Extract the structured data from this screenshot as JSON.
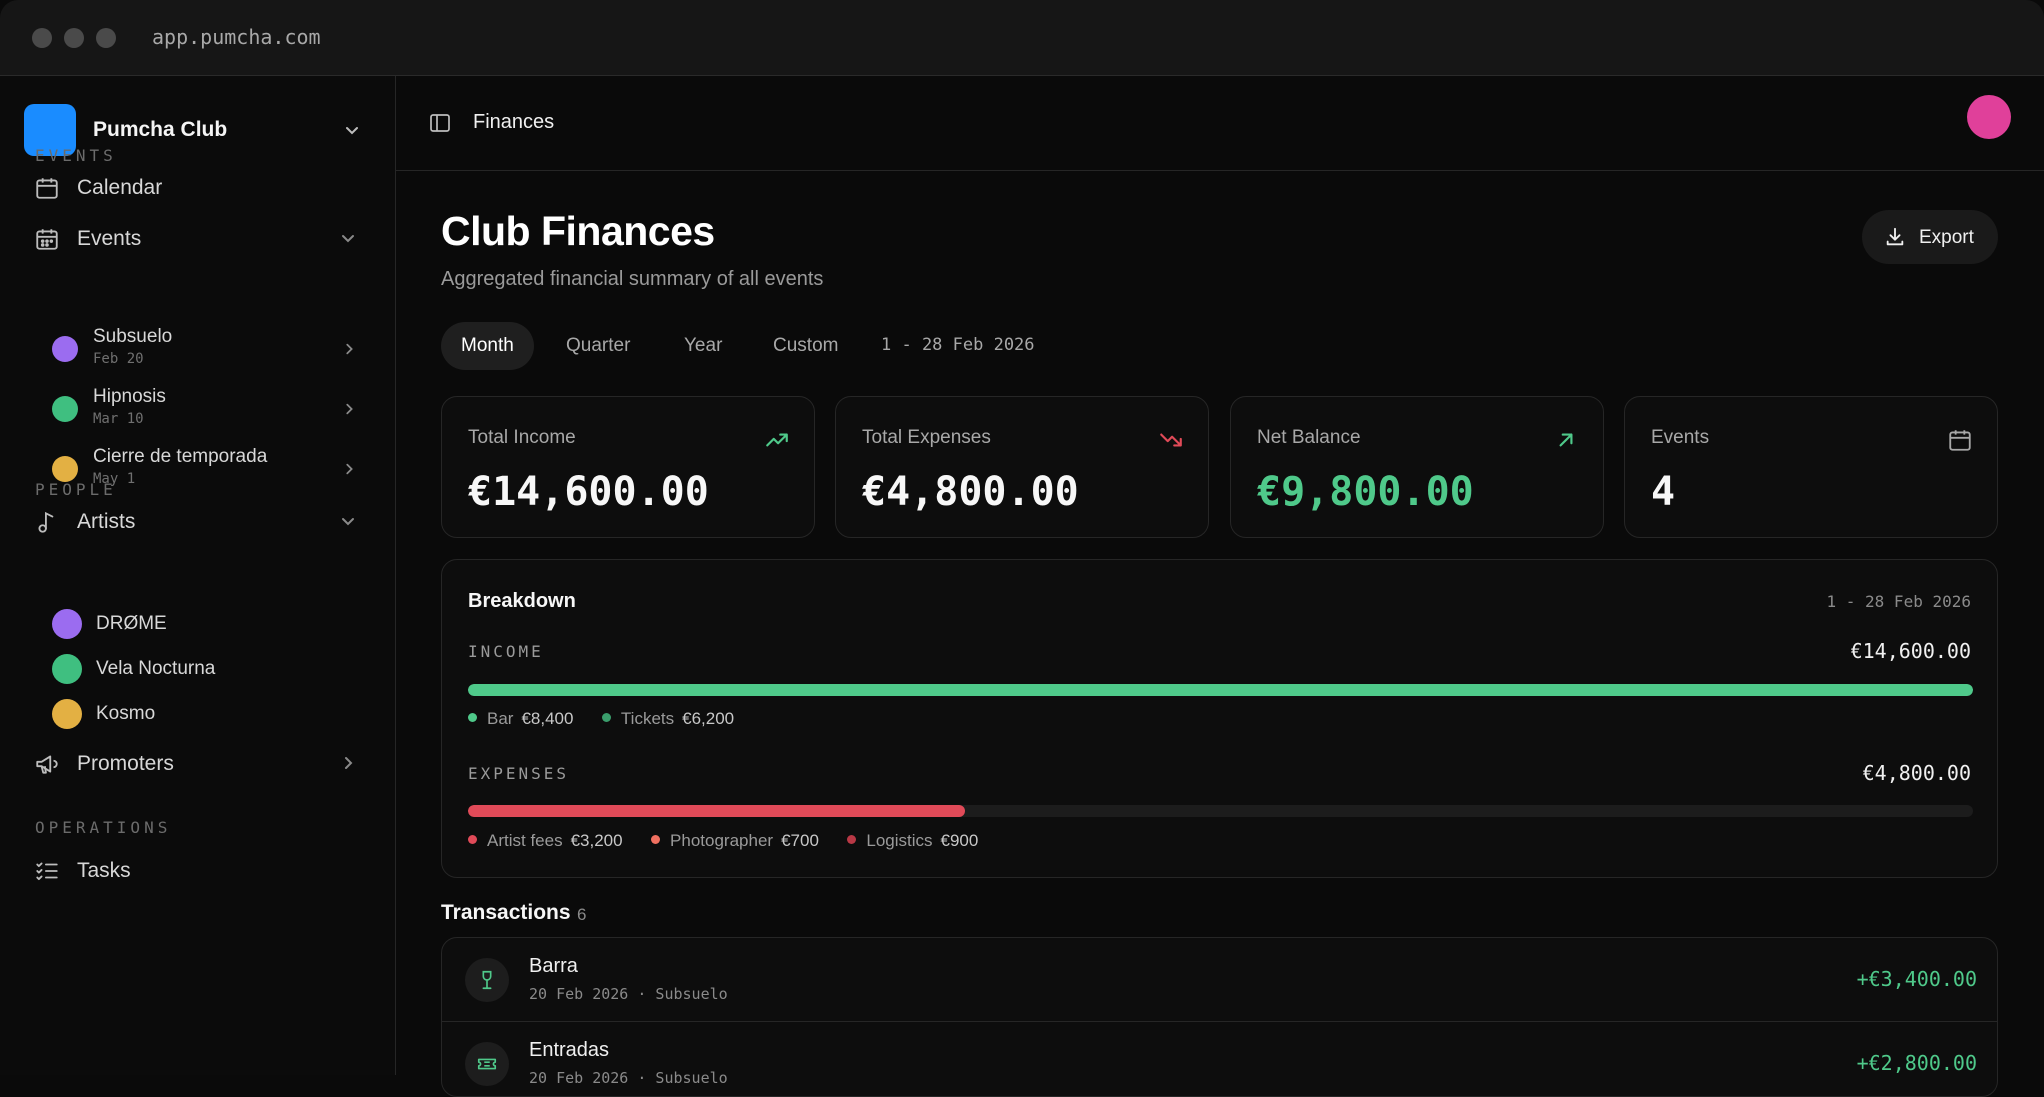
{
  "browser": {
    "url": "app.pumcha.com"
  },
  "club": {
    "name": "Pumcha Club",
    "logo_color": "#1a8cff"
  },
  "sidebar": {
    "sections": {
      "events": "EVENTS",
      "people": "PEOPLE",
      "operations": "OPERATIONS"
    },
    "calendar": "Calendar",
    "events": {
      "label": "Events",
      "items": [
        {
          "name": "Subsuelo",
          "date": "Feb 20",
          "color": "#9b6cf0"
        },
        {
          "name": "Hipnosis",
          "date": "Mar 10",
          "color": "#3fbf80"
        },
        {
          "name": "Cierre de temporada",
          "date": "May 1",
          "color": "#e3b043"
        }
      ]
    },
    "artists": {
      "label": "Artists",
      "items": [
        {
          "name": "DRØME",
          "color": "#9b6cf0"
        },
        {
          "name": "Vela Nocturna",
          "color": "#3fbf80"
        },
        {
          "name": "Kosmo",
          "color": "#e3b043"
        }
      ]
    },
    "promoters": "Promoters",
    "tasks": "Tasks"
  },
  "header": {
    "breadcrumb": "Finances",
    "avatar_color": "#e0409a"
  },
  "page": {
    "title": "Club Finances",
    "subtitle": "Aggregated financial summary of all events",
    "export_label": "Export"
  },
  "period": {
    "tabs": [
      "Month",
      "Quarter",
      "Year",
      "Custom"
    ],
    "active": "Month",
    "range": "1 - 28 Feb 2026"
  },
  "cards": [
    {
      "label": "Total Income",
      "value": "€14,600.00",
      "icon": "trending-up-icon"
    },
    {
      "label": "Total Expenses",
      "value": "€4,800.00",
      "icon": "trending-down-icon"
    },
    {
      "label": "Net Balance",
      "value": "€9,800.00",
      "icon": "arrow-up-right-icon"
    },
    {
      "label": "Events",
      "value": "4",
      "icon": "calendar-icon"
    }
  ],
  "breakdown": {
    "title": "Breakdown",
    "range": "1 - 28 Feb 2026",
    "income": {
      "label": "INCOME",
      "total": "€14,600.00",
      "fill_fraction": 1.0,
      "color": "#4fc98a",
      "items": [
        {
          "name": "Bar",
          "value": "€8,400",
          "color": "#4fc98a"
        },
        {
          "name": "Tickets",
          "value": "€6,200",
          "color": "#3a9e6c"
        }
      ]
    },
    "expenses": {
      "label": "EXPENSES",
      "total": "€4,800.00",
      "fill_fraction": 0.33,
      "color": "#e04a58",
      "items": [
        {
          "name": "Artist fees",
          "value": "€3,200",
          "color": "#e04a58"
        },
        {
          "name": "Photographer",
          "value": "€700",
          "color": "#f07060"
        },
        {
          "name": "Logistics",
          "value": "€900",
          "color": "#b83845"
        }
      ]
    }
  },
  "transactions": {
    "title": "Transactions",
    "count": "6",
    "rows": [
      {
        "name": "Barra",
        "meta": "20 Feb 2026 · Subsuelo",
        "amount": "+€3,400.00",
        "icon": "wine-glass-icon"
      },
      {
        "name": "Entradas",
        "meta": "20 Feb 2026 · Subsuelo",
        "amount": "+€2,800.00",
        "icon": "ticket-icon"
      }
    ]
  }
}
